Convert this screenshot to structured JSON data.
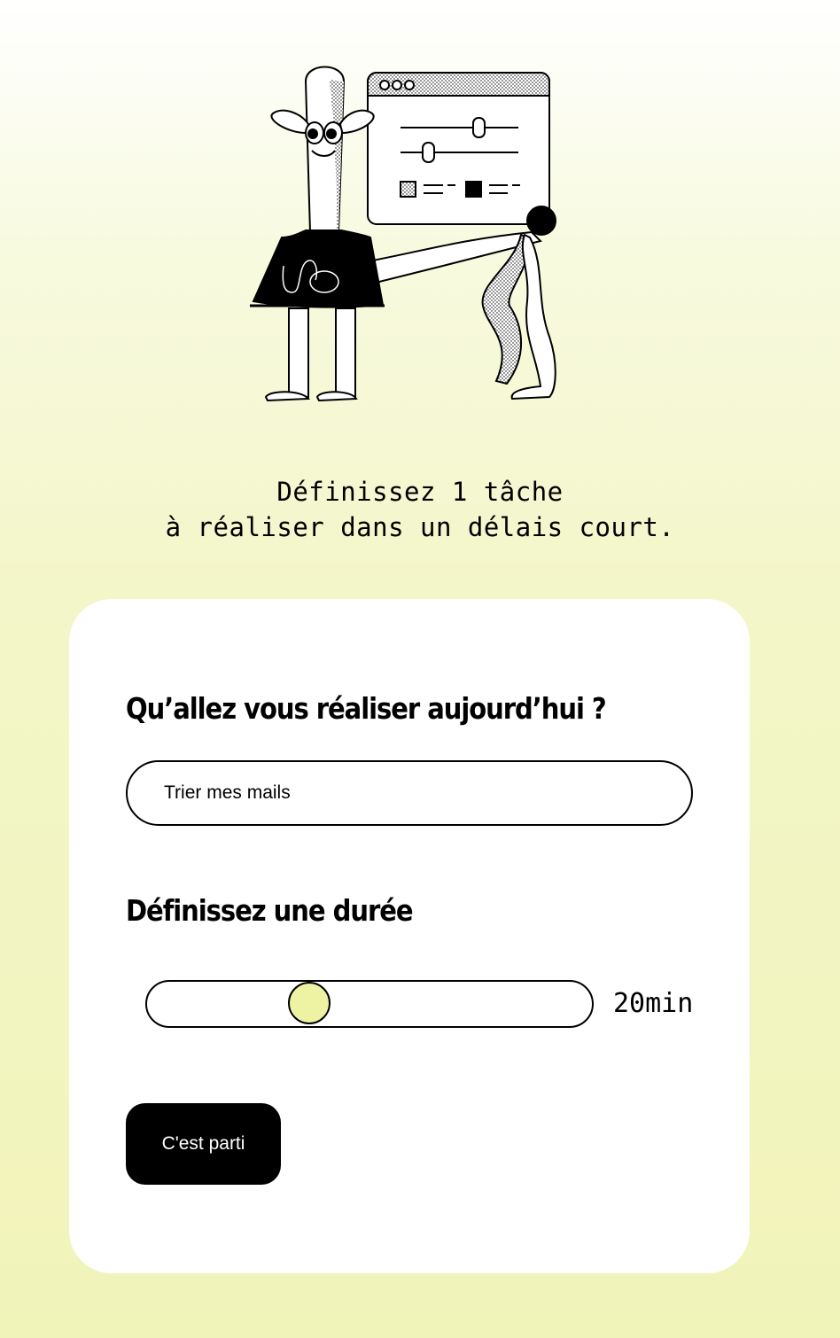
{
  "illustration": {
    "icon": "character-with-settings-window-illustration"
  },
  "intro": {
    "line1": "Définissez 1 tâche",
    "line2": "à réaliser dans un délais court."
  },
  "form": {
    "task_heading": "Qu’allez vous réaliser aujourd’hui ?",
    "task_value": "Trier mes mails",
    "duration_heading": "Définissez une durée",
    "duration_display": "20min",
    "duration_fraction": 0.35,
    "submit_label": "C'est parti"
  },
  "colors": {
    "background": "#f1f4b9",
    "card": "#ffffff",
    "thumb": "#eef3a3",
    "button": "#000000",
    "button_text": "#ffffff"
  }
}
